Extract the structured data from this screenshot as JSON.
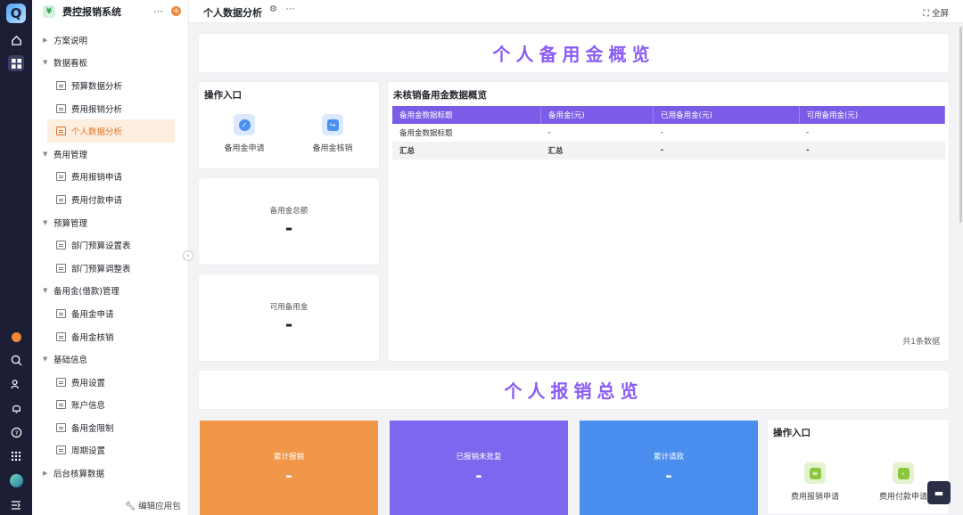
{
  "sidebar": {
    "app_name": "费控报销系统",
    "more": "⋯",
    "add": "+",
    "edit_label": "编辑应用包",
    "items": [
      {
        "label": "方案说明",
        "type": "group",
        "open": false
      },
      {
        "label": "数据看板",
        "type": "group",
        "open": true
      },
      {
        "label": "预算数据分析",
        "type": "leaf"
      },
      {
        "label": "费用报销分析",
        "type": "leaf"
      },
      {
        "label": "个人数据分析",
        "type": "leaf",
        "selected": true
      },
      {
        "label": "费用管理",
        "type": "group",
        "open": true
      },
      {
        "label": "费用报销申请",
        "type": "leaf"
      },
      {
        "label": "费用付款申请",
        "type": "leaf"
      },
      {
        "label": "预算管理",
        "type": "group",
        "open": true
      },
      {
        "label": "部门预算设置表",
        "type": "leaf"
      },
      {
        "label": "部门预算调整表",
        "type": "leaf"
      },
      {
        "label": "备用金(借款)管理",
        "type": "group",
        "open": true
      },
      {
        "label": "备用金申请",
        "type": "leaf"
      },
      {
        "label": "备用金核销",
        "type": "leaf"
      },
      {
        "label": "基础信息",
        "type": "group",
        "open": true
      },
      {
        "label": "费用设置",
        "type": "leaf"
      },
      {
        "label": "账户信息",
        "type": "leaf"
      },
      {
        "label": "备用金限制",
        "type": "leaf"
      },
      {
        "label": "周期设置",
        "type": "leaf"
      },
      {
        "label": "后台核算数据",
        "type": "group",
        "open": false
      }
    ]
  },
  "topbar": {
    "title": "个人数据分析",
    "fullscreen": "全屏"
  },
  "sections": {
    "reserve_banner": "个人备用金概览",
    "expense_banner": "个人报销总览"
  },
  "ops1": {
    "title": "操作入口",
    "buttons": [
      {
        "label": "备用金申请",
        "icon": "check-circle-icon",
        "color": "#4a90f0"
      },
      {
        "label": "备用金核销",
        "icon": "write-off-icon",
        "color": "#4a90f0"
      }
    ]
  },
  "stats": {
    "total_label": "备用金总额",
    "total_value": "-",
    "available_label": "可用备用金",
    "available_value": "-"
  },
  "table": {
    "title": "未核销备用金数据概览",
    "headers": [
      "备用金数据标题",
      "备用金(元)",
      "已用备用金(元)",
      "可用备用金(元)"
    ],
    "rows": [
      [
        "备用金数据标题",
        "-",
        "-",
        "-"
      ]
    ],
    "total_row": [
      "汇总",
      "汇总",
      "-",
      "-"
    ],
    "count_text": "共1条数据"
  },
  "expense_cards": [
    {
      "label": "累计报销",
      "value": "-",
      "color": "#f0974a"
    },
    {
      "label": "已报销未批复",
      "value": "-",
      "color": "#7b68ee"
    },
    {
      "label": "累计请款",
      "value": "-",
      "color": "#4a8ef0"
    }
  ],
  "ops2": {
    "title": "操作入口",
    "buttons": [
      {
        "label": "费用报销申请",
        "icon": "database-icon",
        "color": "#8cc63f"
      },
      {
        "label": "费用付款申请",
        "icon": "terminal-icon",
        "color": "#8cc63f"
      }
    ]
  }
}
